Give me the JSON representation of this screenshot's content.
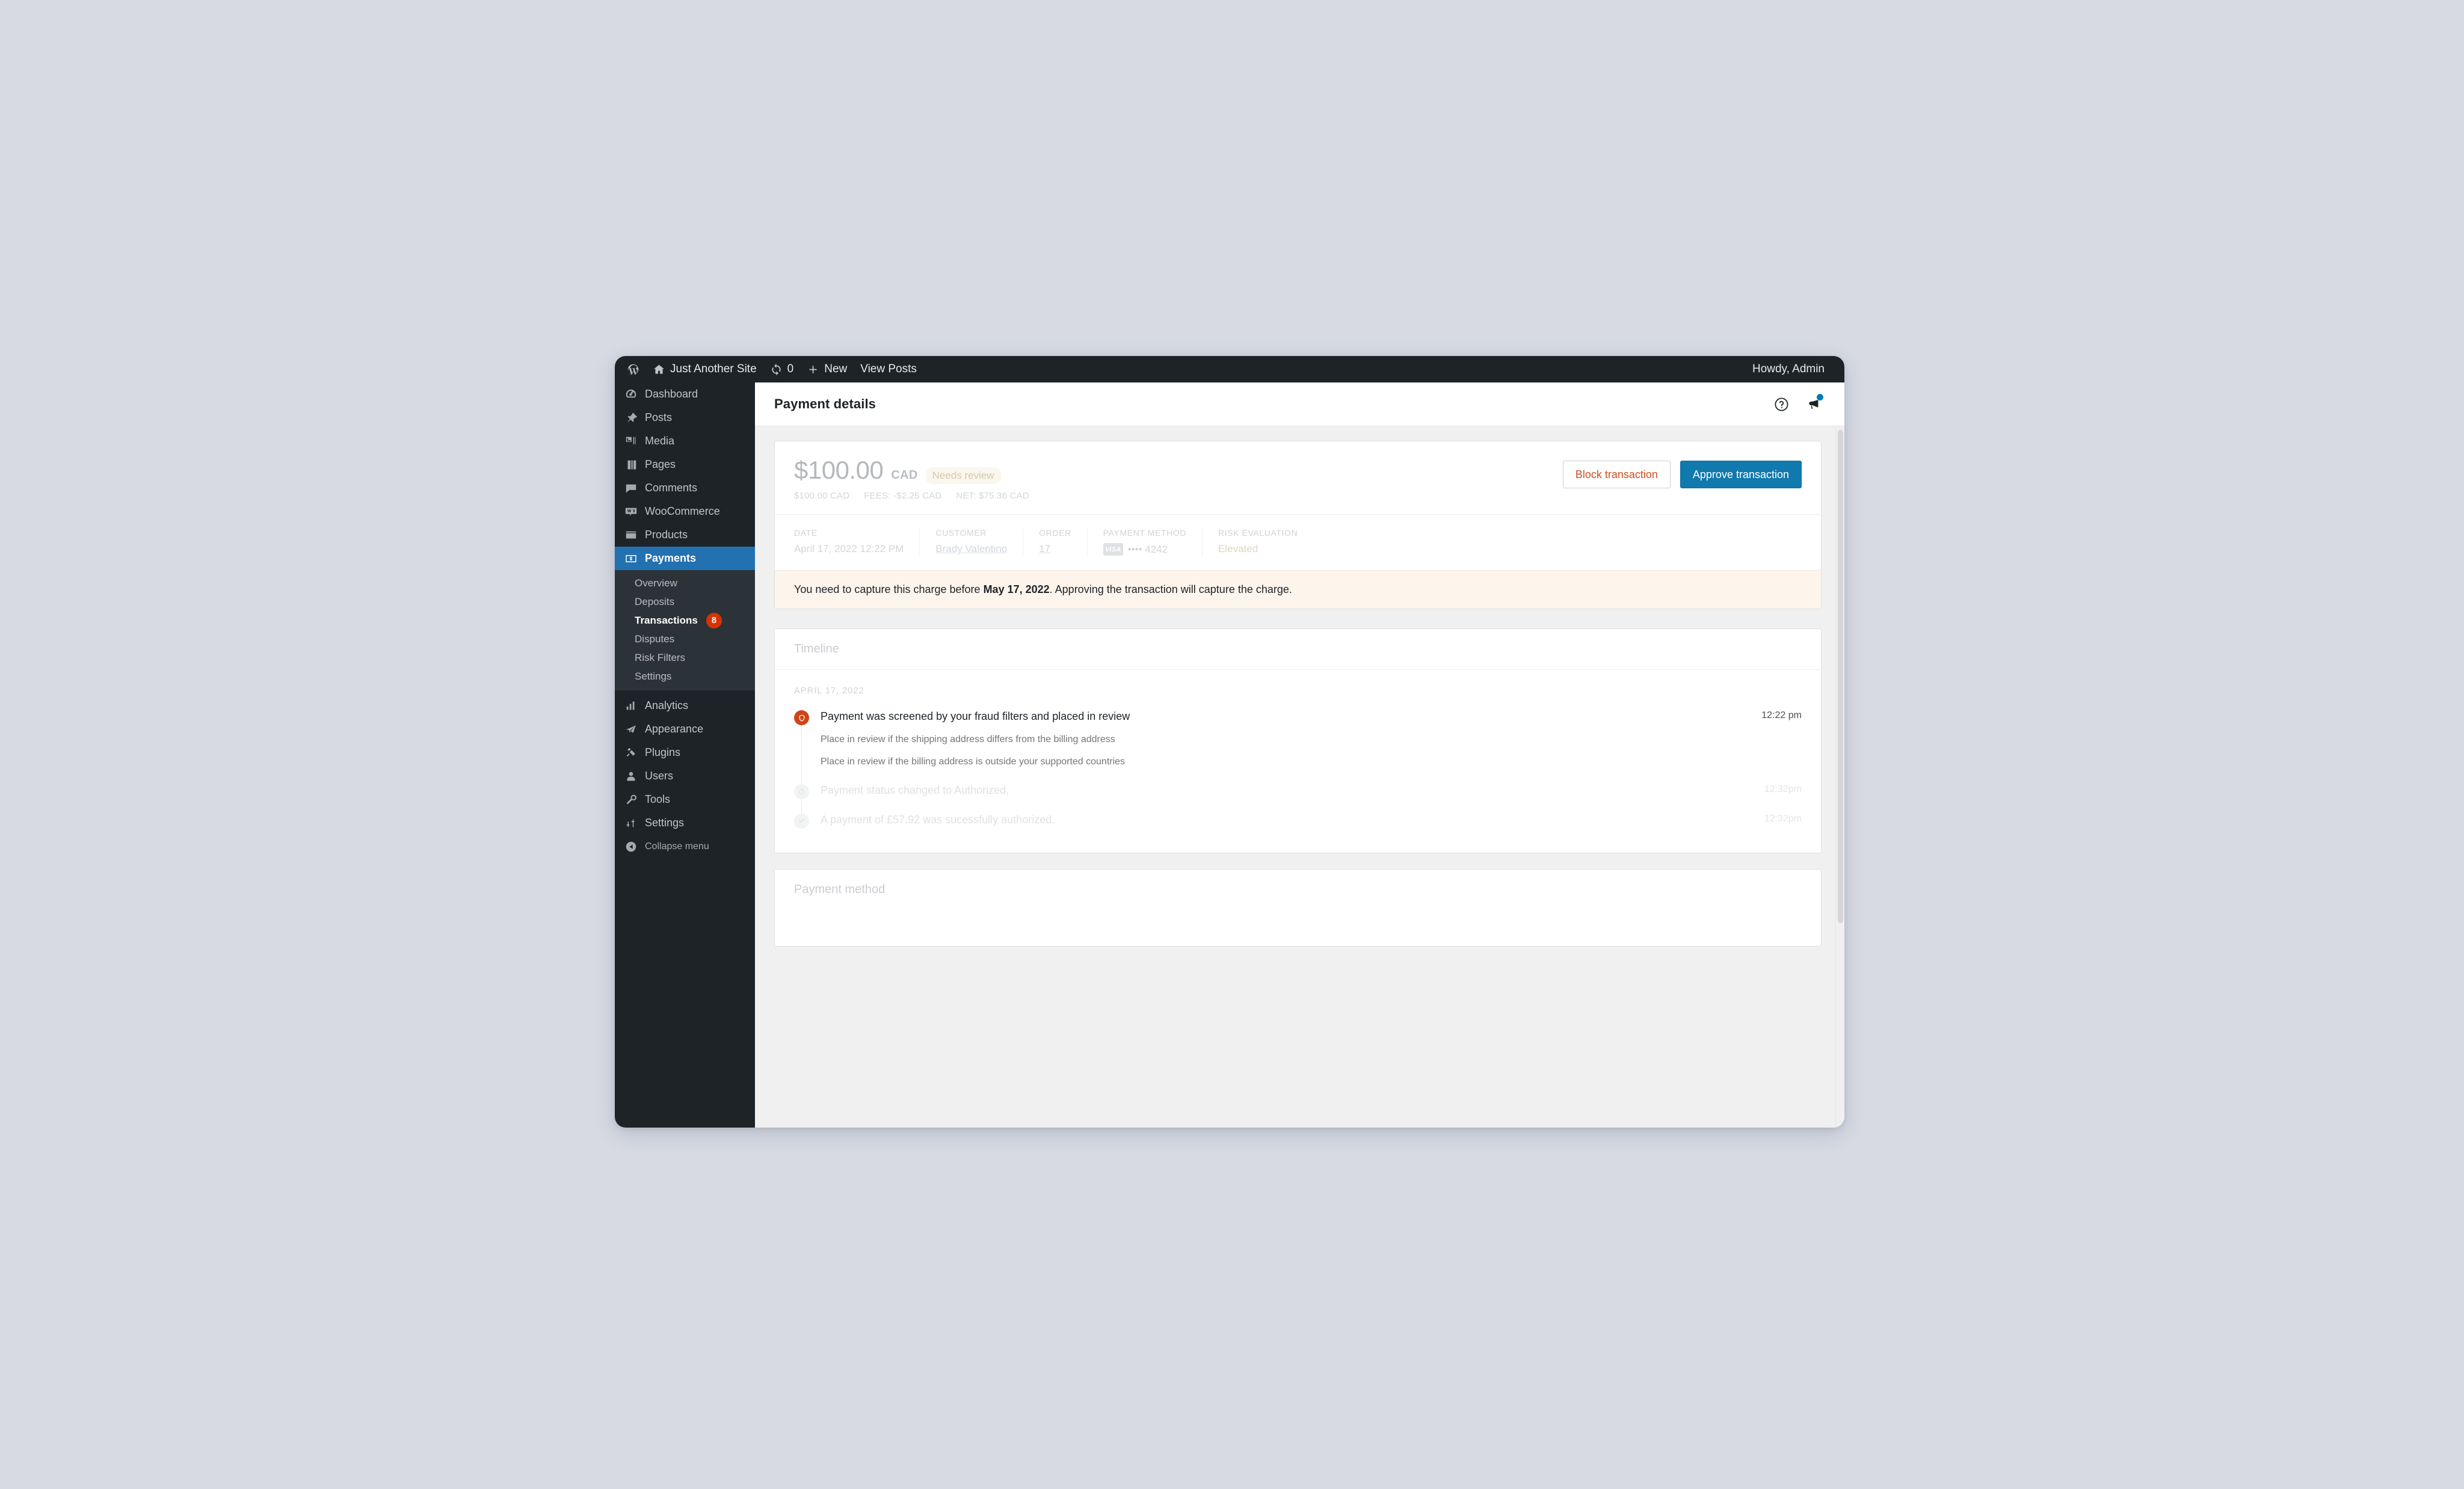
{
  "adminbar": {
    "wp_logo": "wordpress-logo-icon",
    "site_name": "Just Another Site",
    "updates_icon": "updates-icon",
    "updates_count": "0",
    "new_icon": "plus-icon",
    "new_label": "New",
    "view_posts_label": "View Posts",
    "greeting": "Howdy, Admin"
  },
  "sidebar": {
    "items": [
      {
        "label": "Dashboard",
        "icon": "dashboard-icon"
      },
      {
        "label": "Posts",
        "icon": "pin-icon"
      },
      {
        "label": "Media",
        "icon": "media-icon"
      },
      {
        "label": "Pages",
        "icon": "pages-icon"
      },
      {
        "label": "Comments",
        "icon": "comments-icon"
      },
      {
        "label": "WooCommerce",
        "icon": "woocommerce-icon"
      },
      {
        "label": "Products",
        "icon": "products-icon"
      },
      {
        "label": "Payments",
        "icon": "payments-icon"
      }
    ],
    "submenu": [
      {
        "label": "Overview",
        "badge": ""
      },
      {
        "label": "Deposits",
        "badge": ""
      },
      {
        "label": "Transactions",
        "badge": "8"
      },
      {
        "label": "Disputes",
        "badge": ""
      },
      {
        "label": "Risk Filters",
        "badge": ""
      },
      {
        "label": "Settings",
        "badge": ""
      }
    ],
    "items_after": [
      {
        "label": "Analytics",
        "icon": "analytics-icon"
      },
      {
        "label": "Appearance",
        "icon": "appearance-icon"
      },
      {
        "label": "Plugins",
        "icon": "plugins-icon"
      },
      {
        "label": "Users",
        "icon": "users-icon"
      },
      {
        "label": "Tools",
        "icon": "tools-icon"
      },
      {
        "label": "Settings",
        "icon": "settings-icon"
      }
    ],
    "collapse_label": "Collapse menu",
    "collapse_icon": "collapse-arrow-icon",
    "active_item": "Payments",
    "active_subitem": "Transactions",
    "accent_color": "#2271b1",
    "badge_color": "#d63301"
  },
  "page": {
    "title": "Payment details",
    "help_icon": "help-circle-icon",
    "feedback_icon": "megaphone-icon",
    "feedback_dot_color": "#007cba"
  },
  "summary": {
    "amount": "$100.00",
    "currency": "CAD",
    "status": "Needs review",
    "breakdown": [
      "$100.00 CAD",
      "FEES: -$2.25 CAD",
      "NET: $75.36 CAD"
    ],
    "block_button": "Block transaction",
    "approve_button": "Approve transaction",
    "block_button_color": "#cc4f20",
    "approve_button_color": "#1079ad",
    "meta": [
      {
        "label": "DATE",
        "value": "April 17, 2022 12:22 PM",
        "kind": "text"
      },
      {
        "label": "CUSTOMER",
        "value": "Brady Valentino",
        "kind": "link"
      },
      {
        "label": "ORDER",
        "value": "17",
        "kind": "link"
      },
      {
        "label": "PAYMENT METHOD",
        "value": "•••• 4242",
        "kind": "card",
        "brand": "VISA"
      },
      {
        "label": "RISK EVALUATION",
        "value": "Elevated",
        "kind": "risk"
      }
    ],
    "notice_before": "You need to capture this charge before ",
    "notice_bold": "May 17, 2022",
    "notice_after": ". Approving the transaction will capture the charge."
  },
  "timeline": {
    "title": "Timeline",
    "date_group": "APRIL 17, 2022",
    "entries": [
      {
        "icon": "shield-icon",
        "tone": "alert",
        "text": "Payment was screened by your fraud filters and placed in review",
        "time": "12:22 pm",
        "details": [
          "Place in review if the shipping address differs from the billing address",
          "Place in review if the billing address is outside your supported countries"
        ]
      },
      {
        "icon": "refresh-icon",
        "tone": "muted",
        "text": "Payment status changed to Authorized.",
        "time": "12:32pm",
        "details": []
      },
      {
        "icon": "check-icon",
        "tone": "muted",
        "text": "A payment of £57.92 was sucessfully authorized.",
        "time": "12:32pm",
        "details": []
      }
    ]
  },
  "payment_method_card": {
    "title": "Payment method"
  }
}
